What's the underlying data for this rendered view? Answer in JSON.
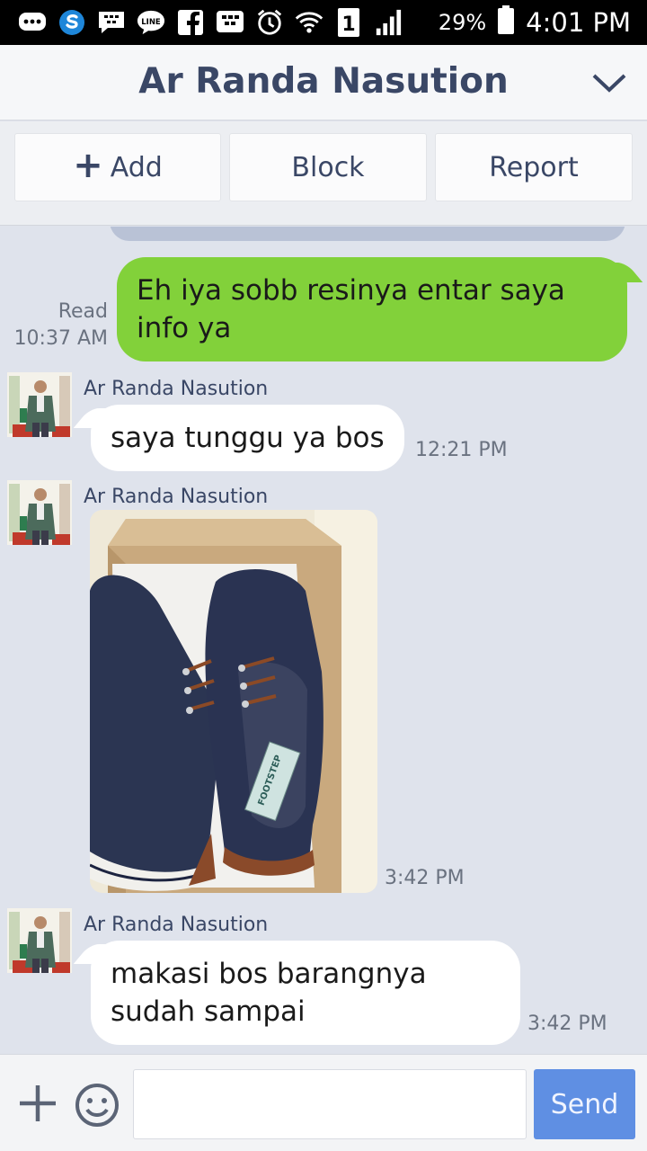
{
  "status_bar": {
    "battery": "29%",
    "time": "4:01 PM",
    "sim": "1",
    "icons": [
      "bbm-icon",
      "skype-icon",
      "bbm-chat-icon",
      "line-icon",
      "facebook-icon",
      "blackberry-icon",
      "alarm-icon",
      "wifi-icon",
      "signal-icon",
      "battery-icon"
    ]
  },
  "header": {
    "title": "Ar Randa Nasution"
  },
  "actions": {
    "add": "Add",
    "block": "Block",
    "report": "Report"
  },
  "messages": [
    {
      "type": "outgoing",
      "status": "Read",
      "time": "10:37 AM",
      "text": "Eh iya sobb resinya entar saya info ya"
    },
    {
      "type": "incoming",
      "sender": "Ar Randa Nasution",
      "text": "saya tunggu ya bos",
      "time": "12:21 PM"
    },
    {
      "type": "incoming-photo",
      "sender": "Ar Randa Nasution",
      "photo_tag": "FOOTSTEP",
      "time": "3:42 PM"
    },
    {
      "type": "incoming",
      "sender": "Ar Randa Nasution",
      "text": "makasi bos barangnya sudah sampai",
      "time": "3:42 PM"
    }
  ],
  "composer": {
    "placeholder": "",
    "send": "Send"
  },
  "colors": {
    "outgoing_bubble": "#82d13a",
    "send_button": "#5f8fe3",
    "chat_background": "#dfe3ec",
    "title": "#3a4766"
  }
}
